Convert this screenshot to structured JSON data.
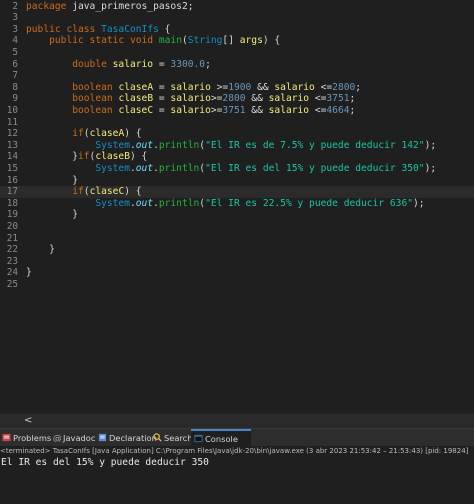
{
  "editor": {
    "lines": [
      {
        "n": "2",
        "text": "package java_primeros_pasos2;"
      },
      {
        "n": "3",
        "text": ""
      },
      {
        "n": "3",
        "text": "public class TasaConIfs {"
      },
      {
        "n": "4",
        "text": "    public static void main(String[] args) {"
      },
      {
        "n": "5",
        "text": ""
      },
      {
        "n": "6",
        "text": "        double salario = 3300.0;"
      },
      {
        "n": "7",
        "text": ""
      },
      {
        "n": "8",
        "text": "        boolean claseA = salario >=1900 && salario <=2800;"
      },
      {
        "n": "9",
        "text": "        boolean claseB = salario>=2800 && salario <=3751;"
      },
      {
        "n": "10",
        "text": "        boolean claseC = salario>=3751 && salario <=4664;"
      },
      {
        "n": "11",
        "text": ""
      },
      {
        "n": "12",
        "text": "        if(claseA) {"
      },
      {
        "n": "13",
        "text": "            System.out.println(\"El IR es de 7.5% y puede deducir 142\");"
      },
      {
        "n": "14",
        "text": "        }if(claseB) {"
      },
      {
        "n": "15",
        "text": "            System.out.println(\"El IR es del 15% y puede deducir 350\");"
      },
      {
        "n": "16",
        "text": "        }"
      },
      {
        "n": "17",
        "text": "        if(claseC) {"
      },
      {
        "n": "18",
        "text": "            System.out.println(\"El IR es 22.5% y puede deducir 636\");"
      },
      {
        "n": "19",
        "text": "        }"
      },
      {
        "n": "20",
        "text": ""
      },
      {
        "n": "21",
        "text": ""
      },
      {
        "n": "22",
        "text": "    }"
      },
      {
        "n": "23",
        "text": ""
      },
      {
        "n": "24",
        "text": "}"
      },
      {
        "n": "25",
        "text": ""
      }
    ]
  },
  "hscroll": {
    "arrow": "<"
  },
  "tabs": [
    {
      "label": "Problems",
      "icon": "problems-icon"
    },
    {
      "label": "Javadoc",
      "icon": "javadoc-icon"
    },
    {
      "label": "Declaration",
      "icon": "declaration-icon"
    },
    {
      "label": "Search",
      "icon": "search-icon"
    },
    {
      "label": "Console",
      "icon": "console-icon",
      "active": true
    }
  ],
  "console": {
    "close_glyph": "✕",
    "header": "<terminated> TasaConIfs [Java Application] C:\\Program Files\\Java\\jdk-20\\bin\\javaw.exe (3 abr 2023 21:53:42 – 21:53:43) [pid: 19824]",
    "output": "El IR es del 15% y puede deducir 350"
  }
}
